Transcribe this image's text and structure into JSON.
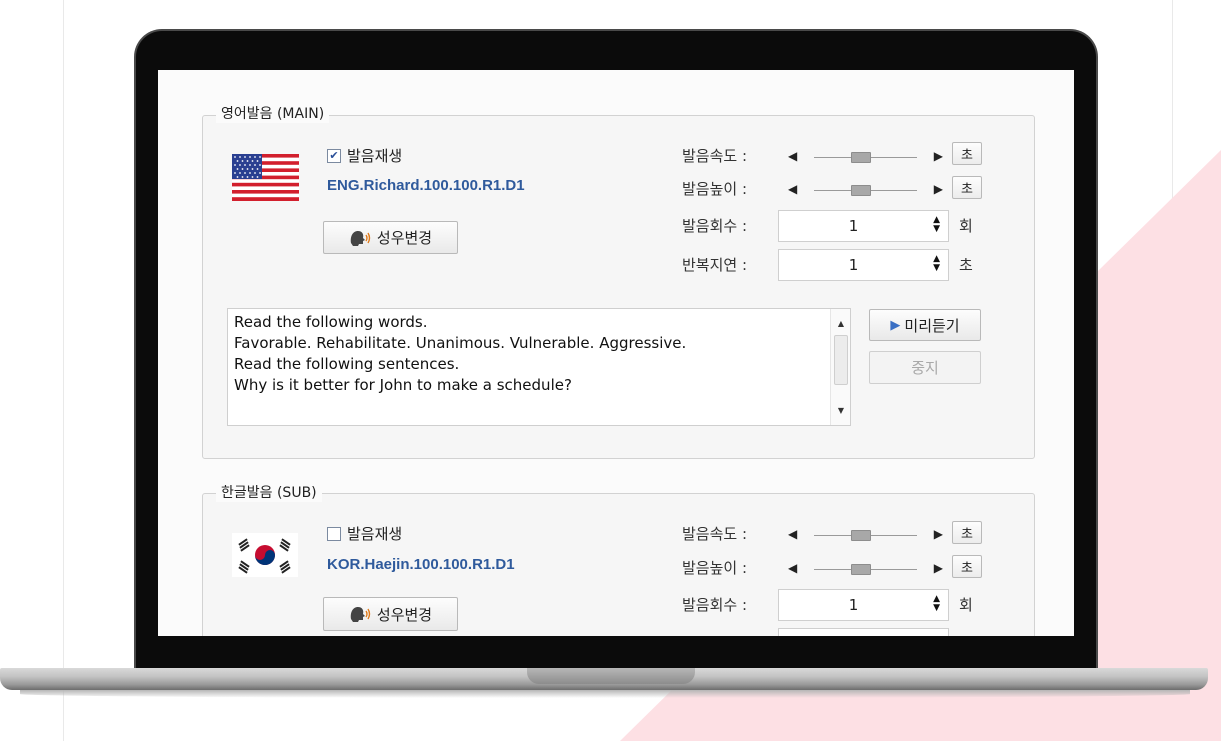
{
  "colors": {
    "accent": "#2f5a9c",
    "pink": "#fde0e4"
  },
  "main": {
    "legend": "영어발음 (MAIN)",
    "play_label": "발음재생",
    "play_checked": true,
    "voice": "ENG.Richard.100.100.R1.D1",
    "change_voice": "성우변경",
    "flag_icon": "us-flag-icon",
    "speed_label": "발음속도 :",
    "pitch_label": "발음높이 :",
    "count_label": "발음회수 :",
    "delay_label": "반복지연 :",
    "init_label": "초",
    "count_value": "1",
    "count_unit": "회",
    "delay_value": "1",
    "delay_unit": "초",
    "preview": "미리듣기",
    "stop": "중지",
    "text_lines": [
      "Read the following words.",
      "Favorable. Rehabilitate. Unanimous. Vulnerable. Aggressive.",
      "Read the following sentences.",
      "Why is it better for John to make a schedule?"
    ]
  },
  "sub": {
    "legend": "한글발음 (SUB)",
    "play_label": "발음재생",
    "play_checked": false,
    "voice": "KOR.Haejin.100.100.R1.D1",
    "change_voice": "성우변경",
    "flag_icon": "kr-flag-icon",
    "speed_label": "발음속도 :",
    "pitch_label": "발음높이 :",
    "count_label": "발음회수 :",
    "init_label": "초",
    "count_value": "1",
    "count_unit": "회"
  }
}
